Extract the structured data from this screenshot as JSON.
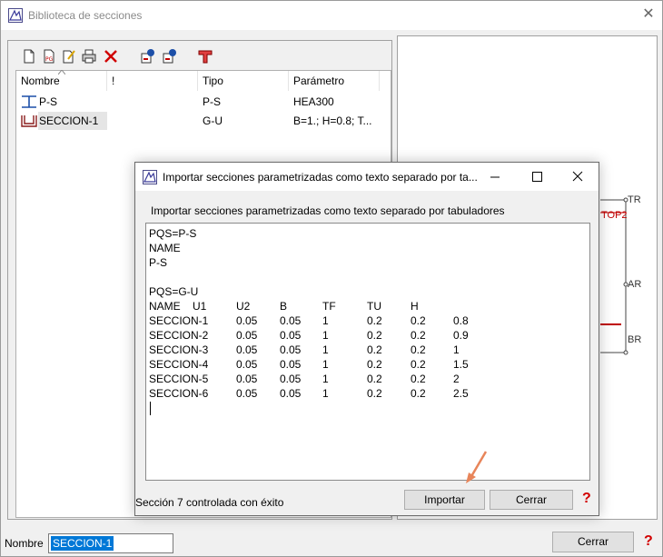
{
  "window": {
    "title": "Biblioteca de secciones",
    "close_glyph": "✕"
  },
  "toolbar": {
    "icons": [
      "new-icon",
      "new-parametric-icon",
      "edit-icon",
      "print-icon",
      "delete-icon",
      "import-icon",
      "export-icon",
      "section-tee-icon"
    ]
  },
  "table": {
    "columns": [
      "Nombre",
      "!",
      "Tipo",
      "Parámetro"
    ],
    "rows": [
      {
        "nombre": "P-S",
        "tipo": "P-S",
        "parametro": "HEA300",
        "icon": "i-profile-icon"
      },
      {
        "nombre": "SECCION-1",
        "tipo": "G-U",
        "parametro": "B=1.; H=0.8; T...",
        "icon": "u-profile-icon"
      }
    ]
  },
  "preview": {
    "labels": {
      "tr": "TR",
      "ar": "AR",
      "br": "BR",
      "top": "TOP2"
    }
  },
  "bottom": {
    "nombre_label": "Nombre",
    "nombre_value": "SECCION-1",
    "close_label": "Cerrar",
    "help_glyph": "?"
  },
  "dialog": {
    "title": "Importar secciones parametrizadas como texto separado por ta...",
    "label": "Importar secciones parametrizadas como texto separado por tabuladores",
    "text_lines": [
      [
        "PQS=P-S"
      ],
      [
        "NAME"
      ],
      [
        "P-S"
      ],
      [
        ""
      ],
      [
        "PQS=G-U"
      ],
      [
        "NAME",
        "U1",
        "U2",
        "B",
        "TF",
        "TU",
        "H"
      ],
      [
        "SECCION-1",
        "0.05",
        "0.05",
        "1",
        "0.2",
        "0.2",
        "0.8"
      ],
      [
        "SECCION-2",
        "0.05",
        "0.05",
        "1",
        "0.2",
        "0.2",
        "0.9"
      ],
      [
        "SECCION-3",
        "0.05",
        "0.05",
        "1",
        "0.2",
        "0.2",
        "1"
      ],
      [
        "SECCION-4",
        "0.05",
        "0.05",
        "1",
        "0.2",
        "0.2",
        "1.5"
      ],
      [
        "SECCION-5",
        "0.05",
        "0.05",
        "1",
        "0.2",
        "0.2",
        "2"
      ],
      [
        "SECCION-6",
        "0.05",
        "0.05",
        "1",
        "0.2",
        "0.2",
        "2.5"
      ]
    ],
    "status": "Sección 7 controlada con éxito",
    "import_label": "Importar",
    "close_label": "Cerrar",
    "help_glyph": "?"
  },
  "colors": {
    "selection": "#0078d7",
    "help": "#d20000",
    "arrow": "#e8855a",
    "preview_accent": "#c00000"
  }
}
